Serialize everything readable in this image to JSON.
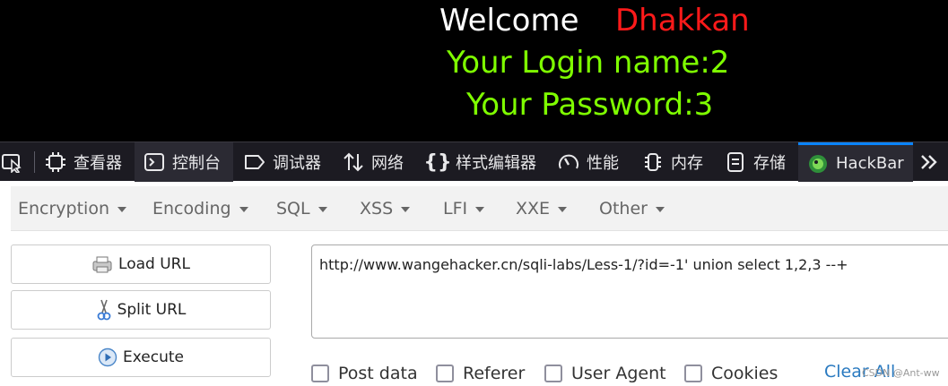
{
  "page": {
    "welcome": "Welcome",
    "username": "Dhakkan",
    "login_line": "Your Login name:2",
    "password_line": "Your Password:3"
  },
  "devtools": {
    "tabs": [
      {
        "label": "查看器",
        "icon": "inspector-icon"
      },
      {
        "label": "控制台",
        "icon": "console-icon"
      },
      {
        "label": "调试器",
        "icon": "debugger-icon"
      },
      {
        "label": "网络",
        "icon": "network-icon"
      },
      {
        "label": "样式编辑器",
        "icon": "style-editor-icon"
      },
      {
        "label": "性能",
        "icon": "performance-icon"
      },
      {
        "label": "内存",
        "icon": "memory-icon"
      },
      {
        "label": "存储",
        "icon": "storage-icon"
      },
      {
        "label": "HackBar",
        "icon": "hackbar-icon"
      }
    ],
    "active_tab": "HackBar",
    "colors": {
      "background": "#1c1b22",
      "selected": "#0a84ff",
      "text": "#e8e8ea"
    }
  },
  "hackbar": {
    "menu": [
      "Encryption",
      "Encoding",
      "SQL",
      "XSS",
      "LFI",
      "XXE",
      "Other"
    ],
    "buttons": {
      "load": "Load URL",
      "split": "Split URL",
      "execute": "Execute"
    },
    "url": "http://www.wangehacker.cn/sqli-labs/Less-1/?id=-1' union select 1,2,3 --+",
    "checkboxes": [
      "Post data",
      "Referer",
      "User Agent",
      "Cookies"
    ],
    "clear_all": "Clear All",
    "watermark": "CSDN @Ant-ww"
  },
  "colors": {
    "username": "#ff1a1a",
    "login_text": "#7fff00",
    "link": "#2a7ac0"
  }
}
